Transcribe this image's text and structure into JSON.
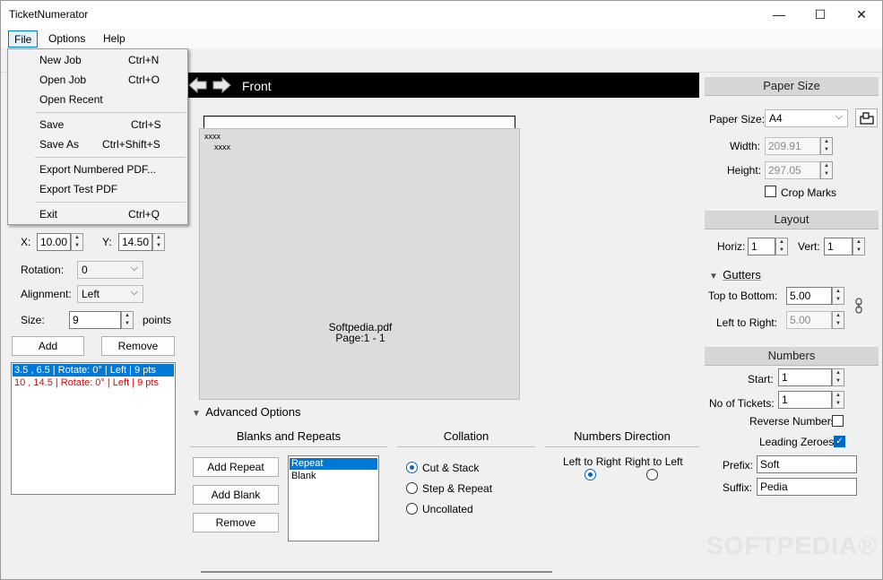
{
  "window": {
    "title": "TicketNumerator",
    "minimize": "—",
    "maximize": "☐",
    "close": "✕"
  },
  "menubar": {
    "file": "File",
    "options": "Options",
    "help": "Help"
  },
  "file_menu": {
    "new_job": "New Job",
    "new_job_sc": "Ctrl+N",
    "open_job": "Open Job",
    "open_job_sc": "Ctrl+O",
    "open_recent": "Open Recent",
    "save": "Save",
    "save_sc": "Ctrl+S",
    "save_as": "Save As",
    "save_as_sc": "Ctrl+Shift+S",
    "export_numbered": "Export Numbered PDF...",
    "export_test": "Export Test PDF",
    "exit": "Exit",
    "exit_sc": "Ctrl+Q"
  },
  "left_panel": {
    "x_label": "X:",
    "x_value": "10.00",
    "y_label": "Y:",
    "y_value": "14.50",
    "rotation_label": "Rotation:",
    "rotation_value": "0",
    "alignment_label": "Alignment:",
    "alignment_value": "Left",
    "size_label": "Size:",
    "size_value": "9",
    "size_unit": "points",
    "add_label": "Add",
    "remove_label": "Remove",
    "items": [
      "3.5 , 6.5 | Rotate: 0° | Left | 9 pts",
      "10 , 14.5 | Rotate: 0° | Left | 9 pts"
    ]
  },
  "preview": {
    "side_label": "Front",
    "marker": "xxxx",
    "file_name": "Softpedia.pdf",
    "page_info": "Page:1 - 1"
  },
  "advanced": {
    "title": "Advanced Options",
    "blanks_title": "Blanks and Repeats",
    "add_repeat": "Add Repeat",
    "add_blank": "Add Blank",
    "remove": "Remove",
    "list": [
      "Repeat",
      "Blank"
    ],
    "collation_title": "Collation",
    "collation_options": [
      "Cut & Stack",
      "Step & Repeat",
      "Uncollated"
    ],
    "direction_title": "Numbers Direction",
    "ltr": "Left to Right",
    "rtl": "Right to Left"
  },
  "paper": {
    "title": "Paper Size",
    "size_label": "Paper Size:",
    "size_value": "A4",
    "width_label": "Width:",
    "width_value": "209.91",
    "height_label": "Height:",
    "height_value": "297.05",
    "crop_marks": "Crop Marks"
  },
  "layout": {
    "title": "Layout",
    "horiz_label": "Horiz:",
    "horiz_value": "1",
    "vert_label": "Vert:",
    "vert_value": "1",
    "gutters": "Gutters",
    "top_bottom_label": "Top to Bottom:",
    "top_bottom_value": "5.00",
    "left_right_label": "Left to Right:",
    "left_right_value": "5.00"
  },
  "numbers": {
    "title": "Numbers",
    "start_label": "Start:",
    "start_value": "1",
    "tickets_label": "No of Tickets:",
    "tickets_value": "1",
    "reverse_label": "Reverse Numbers",
    "leading_label": "Leading Zeroes",
    "prefix_label": "Prefix:",
    "prefix_value": "Soft",
    "suffix_label": "Suffix:",
    "suffix_value": "Pedia"
  },
  "watermark": "SOFTPEDIA®",
  "colors": {
    "accent": "#0078d7",
    "selection": "#0078d7",
    "error_text": "#e00000"
  }
}
